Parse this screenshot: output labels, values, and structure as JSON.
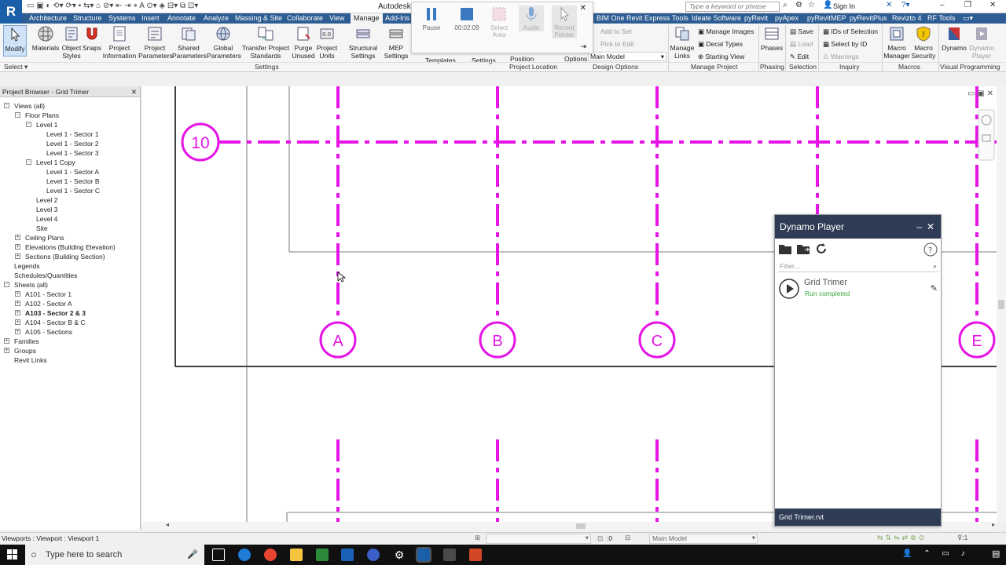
{
  "app": {
    "title": "Autodesk R",
    "logo": "R",
    "search_placeholder": "Type a keyword or phrase",
    "sign_in": "Sign In"
  },
  "tabs": [
    "Architecture",
    "Structure",
    "Systems",
    "Insert",
    "Annotate",
    "Analyze",
    "Massing & Site",
    "Collaborate",
    "View",
    "Manage",
    "Add-Ins",
    "BIM One",
    "Revit Express Tools",
    "Ideate Software",
    "pyRevit",
    "pyApex",
    "pyRevitMEP",
    "pyRevitPlus",
    "Revizto 4",
    "RF Tools"
  ],
  "active_tab": "Manage",
  "ribbon": {
    "buttons": [
      {
        "label": "Modify",
        "icon": "cursor-icon"
      },
      {
        "label": "Materials",
        "icon": "materials-icon"
      },
      {
        "label": "Object Styles",
        "icon": "object-styles-icon"
      },
      {
        "label": "Snaps",
        "icon": "snaps-magnet-icon"
      },
      {
        "label": "Project Information",
        "icon": "project-info-icon"
      },
      {
        "label": "Project Parameters",
        "icon": "project-parameters-icon"
      },
      {
        "label": "Shared Parameters",
        "icon": "shared-parameters-icon"
      },
      {
        "label": "Global Parameters",
        "icon": "global-parameters-icon"
      },
      {
        "label": "Transfer Project Standards",
        "icon": "transfer-standards-icon"
      },
      {
        "label": "Purge Unused",
        "icon": "purge-icon"
      },
      {
        "label": "Project Units",
        "icon": "units-icon"
      },
      {
        "label": "Structural Settings",
        "icon": "structural-settings-icon"
      },
      {
        "label": "MEP Settings",
        "icon": "mep-settings-icon"
      },
      {
        "label": "Manage Links",
        "icon": "manage-links-icon"
      },
      {
        "label": "Phases",
        "icon": "phases-icon"
      },
      {
        "label": "Macro Manager",
        "icon": "macro-manager-icon"
      },
      {
        "label": "Macro Security",
        "icon": "macro-security-icon"
      },
      {
        "label": "Dynamo",
        "icon": "dynamo-icon"
      },
      {
        "label": "Dynamo Player",
        "icon": "dynamo-player-icon"
      }
    ],
    "small_items": {
      "add_to_set": "Add to Set",
      "pick_to_edit": "Pick to Edit",
      "main_model": "Main Model",
      "position": "Position",
      "manage_images": "Manage Images",
      "decal_types": "Decal Types",
      "starting_view": "Starting View",
      "save": "Save",
      "load": "Load",
      "edit": "Edit",
      "ids_of_selection": "IDs of Selection",
      "select_by_id": "Select by ID",
      "warnings": "Warnings",
      "templates": "Templates",
      "settings": "Settings",
      "options": "Options"
    },
    "panels": [
      "Select",
      "Settings",
      "Project Location",
      "Design Options",
      "Manage Project",
      "Phasing",
      "Selection",
      "Inquiry",
      "Macros",
      "Visual Programming"
    ]
  },
  "recorder": {
    "pause": "Pause",
    "time": "00:02:09",
    "select_area": "Select Area",
    "audio": "Audio",
    "record_pointer": "Record Pointer"
  },
  "browser": {
    "title": "Project Browser - Grid Trimer",
    "items": [
      {
        "label": "Views (all)",
        "level": 0,
        "exp": "-"
      },
      {
        "label": "Floor Plans",
        "level": 1,
        "exp": "-"
      },
      {
        "label": "Level 1",
        "level": 2,
        "exp": "-"
      },
      {
        "label": "Level 1 - Sector 1",
        "level": 3,
        "exp": ""
      },
      {
        "label": "Level 1 - Sector 2",
        "level": 3,
        "exp": ""
      },
      {
        "label": "Level 1 - Sector 3",
        "level": 3,
        "exp": ""
      },
      {
        "label": "Level 1 Copy",
        "level": 2,
        "exp": "-"
      },
      {
        "label": "Level 1 - Sector A",
        "level": 3,
        "exp": ""
      },
      {
        "label": "Level 1 - Sector B",
        "level": 3,
        "exp": ""
      },
      {
        "label": "Level 1 - Sector C",
        "level": 3,
        "exp": ""
      },
      {
        "label": "Level 2",
        "level": 2,
        "exp": ""
      },
      {
        "label": "Level 3",
        "level": 2,
        "exp": ""
      },
      {
        "label": "Level 4",
        "level": 2,
        "exp": ""
      },
      {
        "label": "Site",
        "level": 2,
        "exp": ""
      },
      {
        "label": "Ceiling Plans",
        "level": 1,
        "exp": "+"
      },
      {
        "label": "Elevations (Building Elevation)",
        "level": 1,
        "exp": "+"
      },
      {
        "label": "Sections (Building Section)",
        "level": 1,
        "exp": "+"
      },
      {
        "label": "Legends",
        "level": 0,
        "exp": ""
      },
      {
        "label": "Schedules/Quantities",
        "level": 0,
        "exp": ""
      },
      {
        "label": "Sheets (all)",
        "level": 0,
        "exp": "-"
      },
      {
        "label": "A101 - Sector 1",
        "level": 1,
        "exp": "+"
      },
      {
        "label": "A102 - Sector A",
        "level": 1,
        "exp": "+"
      },
      {
        "label": "A103 - Sector 2 & 3",
        "level": 1,
        "exp": "+",
        "bold": true
      },
      {
        "label": "A104 - Sector B & C",
        "level": 1,
        "exp": "+"
      },
      {
        "label": "A105 - Sections",
        "level": 1,
        "exp": "+"
      },
      {
        "label": "Families",
        "level": 0,
        "exp": "+"
      },
      {
        "label": "Groups",
        "level": 0,
        "exp": "+"
      },
      {
        "label": "Revit Links",
        "level": 0,
        "exp": ""
      }
    ]
  },
  "canvas": {
    "grid_color": "#e614e6",
    "bubbles": [
      "10",
      "A",
      "B",
      "C",
      "E"
    ]
  },
  "dynamo": {
    "title": "Dynamo Player",
    "filter_placeholder": "Filter...",
    "script_name": "Grid Trimer",
    "script_status": "Run completed",
    "footer_file": "Grid Trimer.rvt",
    "status_color": "#3aa53a"
  },
  "status": {
    "text": "Viewports : Viewport : Viewport 1",
    "scale_value": ":0",
    "model": "Main Model"
  },
  "taskbar": {
    "search_placeholder": "Type here to search"
  }
}
